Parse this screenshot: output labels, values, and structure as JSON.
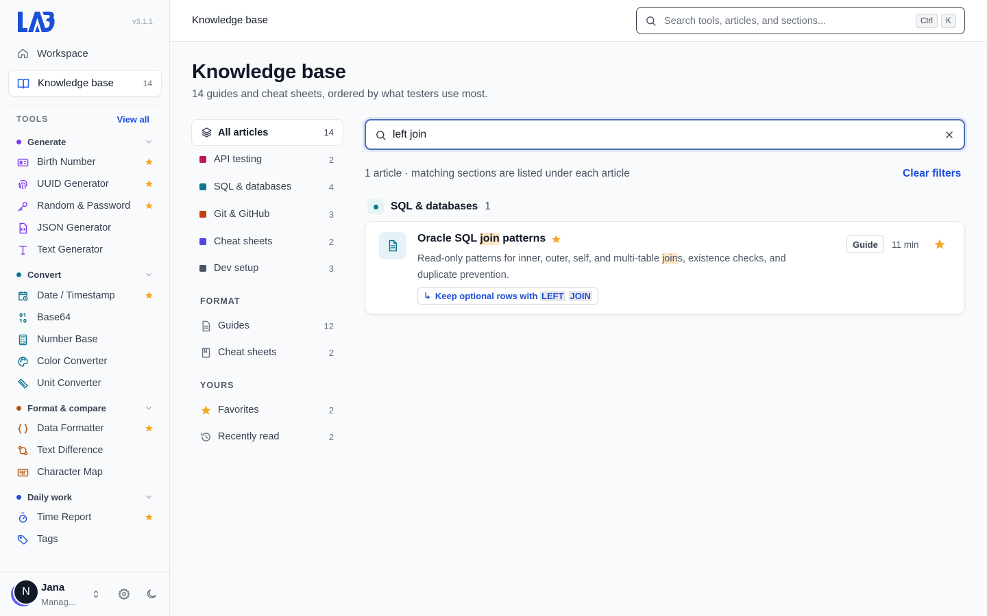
{
  "app": {
    "version": "v3.1.1"
  },
  "colors": {
    "accent": "#1d4ed8",
    "star": "#f5a623",
    "generate": "#7c3aed",
    "convert": "#0e7490",
    "format_compare": "#b45309",
    "daily_work": "#1d4ed8"
  },
  "sidebar": {
    "workspace_label": "Workspace",
    "kb_label": "Knowledge base",
    "kb_count": "14",
    "tools_heading": "TOOLS",
    "view_all": "View all",
    "groups": [
      {
        "label": "Generate",
        "items": [
          {
            "label": "Birth Number",
            "icon": "id-card-icon",
            "favorite": true
          },
          {
            "label": "UUID Generator",
            "icon": "fingerprint-icon",
            "favorite": true
          },
          {
            "label": "Random & Password",
            "icon": "key-icon",
            "favorite": true
          },
          {
            "label": "JSON Generator",
            "icon": "file-code-icon",
            "favorite": false
          },
          {
            "label": "Text Generator",
            "icon": "text-icon",
            "favorite": false
          }
        ]
      },
      {
        "label": "Convert",
        "items": [
          {
            "label": "Date / Timestamp",
            "icon": "calendar-clock-icon",
            "favorite": true
          },
          {
            "label": "Base64",
            "icon": "binary-icon",
            "favorite": false
          },
          {
            "label": "Number Base",
            "icon": "calculator-icon",
            "favorite": false
          },
          {
            "label": "Color Converter",
            "icon": "palette-icon",
            "favorite": false
          },
          {
            "label": "Unit Converter",
            "icon": "ruler-icon",
            "favorite": false
          }
        ]
      },
      {
        "label": "Format & compare",
        "items": [
          {
            "label": "Data Formatter",
            "icon": "braces-icon",
            "favorite": true
          },
          {
            "label": "Text Difference",
            "icon": "diff-icon",
            "favorite": false
          },
          {
            "label": "Character Map",
            "icon": "keyboard-icon",
            "favorite": false
          }
        ]
      },
      {
        "label": "Daily work",
        "items": [
          {
            "label": "Time Report",
            "icon": "timer-icon",
            "favorite": true
          },
          {
            "label": "Tags",
            "icon": "tag-icon",
            "favorite": false
          }
        ]
      }
    ],
    "user": {
      "initial": "N",
      "name": "Jana",
      "role": "Manag..."
    }
  },
  "topbar": {
    "title": "Knowledge base",
    "search_placeholder": "Search tools, articles, and sections...",
    "kbd_ctrl": "Ctrl",
    "kbd_k": "K"
  },
  "main": {
    "title": "Knowledge base",
    "subtitle": "14 guides and cheat sheets, ordered by what testers use most.",
    "categories": {
      "all": {
        "label": "All articles",
        "count": "14"
      },
      "topics": [
        {
          "label": "API testing",
          "count": "2",
          "color": "#be185d"
        },
        {
          "label": "SQL & databases",
          "count": "4",
          "color": "#0e7490"
        },
        {
          "label": "Git & GitHub",
          "count": "3",
          "color": "#c2410c"
        },
        {
          "label": "Cheat sheets",
          "count": "2",
          "color": "#4f46e5"
        },
        {
          "label": "Dev setup",
          "count": "3",
          "color": "#4b5563"
        }
      ],
      "format_heading": "FORMAT",
      "formats": [
        {
          "label": "Guides",
          "count": "12"
        },
        {
          "label": "Cheat sheets",
          "count": "2"
        }
      ],
      "yours_heading": "YOURS",
      "yours": [
        {
          "label": "Favorites",
          "count": "2"
        },
        {
          "label": "Recently read",
          "count": "2"
        }
      ]
    },
    "article_search": {
      "value": "left join"
    },
    "result_summary": "1 article · matching sections are listed under each article",
    "clear_filters": "Clear filters",
    "group": {
      "label": "SQL & databases",
      "count": "1"
    },
    "article": {
      "title_before": "Oracle SQL ",
      "title_highlight": "join",
      "title_after": " patterns",
      "desc_before": "Read-only patterns for inner, outer, self, and multi-table ",
      "desc_highlight": "join",
      "desc_after": "s, existence checks, and duplicate prevention.",
      "section_arrow": "↳",
      "section_before": "Keep optional rows with ",
      "section_hl1": "LEFT",
      "section_hl2": "JOIN",
      "badge": "Guide",
      "read_time": "11 min"
    }
  }
}
